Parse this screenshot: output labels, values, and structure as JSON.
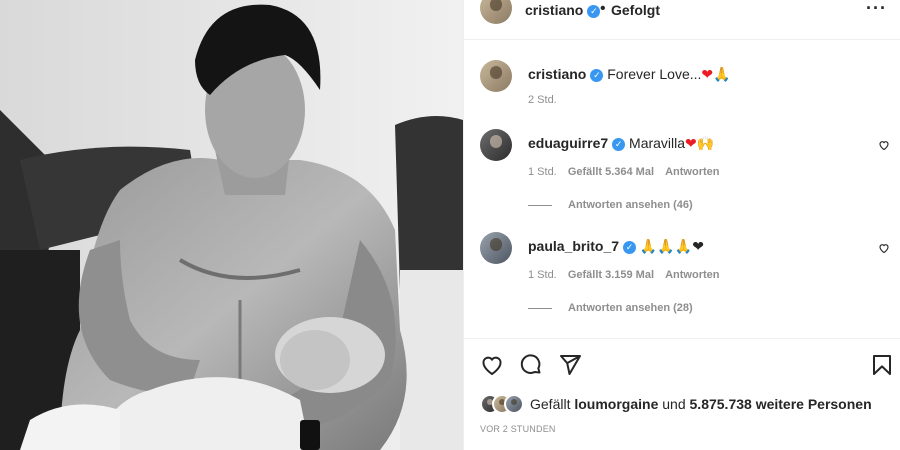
{
  "header": {
    "username": "cristiano",
    "separator": "•",
    "follow_state": "Gefolgt",
    "more_label": "···"
  },
  "caption": {
    "username": "cristiano",
    "text": "Forever Love...",
    "emojis": "❤🙏",
    "time": "2 Std."
  },
  "comments": [
    {
      "username": "eduaguirre7",
      "text": "Maravilla",
      "emojis": "❤🙌",
      "time": "1 Std.",
      "likes": "Gefällt 5.364 Mal",
      "reply_label": "Antworten",
      "view_replies": "Antworten ansehen (46)"
    },
    {
      "username": "paula_brito_7",
      "text": "",
      "emojis": "🙏🙏🙏❤",
      "time": "1 Std.",
      "likes": "Gefällt 3.159 Mal",
      "reply_label": "Antworten",
      "view_replies": "Antworten ansehen (28)"
    }
  ],
  "likes_line": {
    "prefix": "Gefällt",
    "user": "loumorgaine",
    "mid": "und",
    "count": "5.875.738 weitere Personen"
  },
  "posted": "VOR 2 STUNDEN",
  "icons": [
    "heart-icon",
    "comment-icon",
    "share-icon",
    "bookmark-icon",
    "verified-badge-icon"
  ],
  "colors": {
    "accent_blue": "#3897f0",
    "heart_red": "#ed1c24",
    "muted": "#8e8e8e",
    "text": "#262626"
  }
}
